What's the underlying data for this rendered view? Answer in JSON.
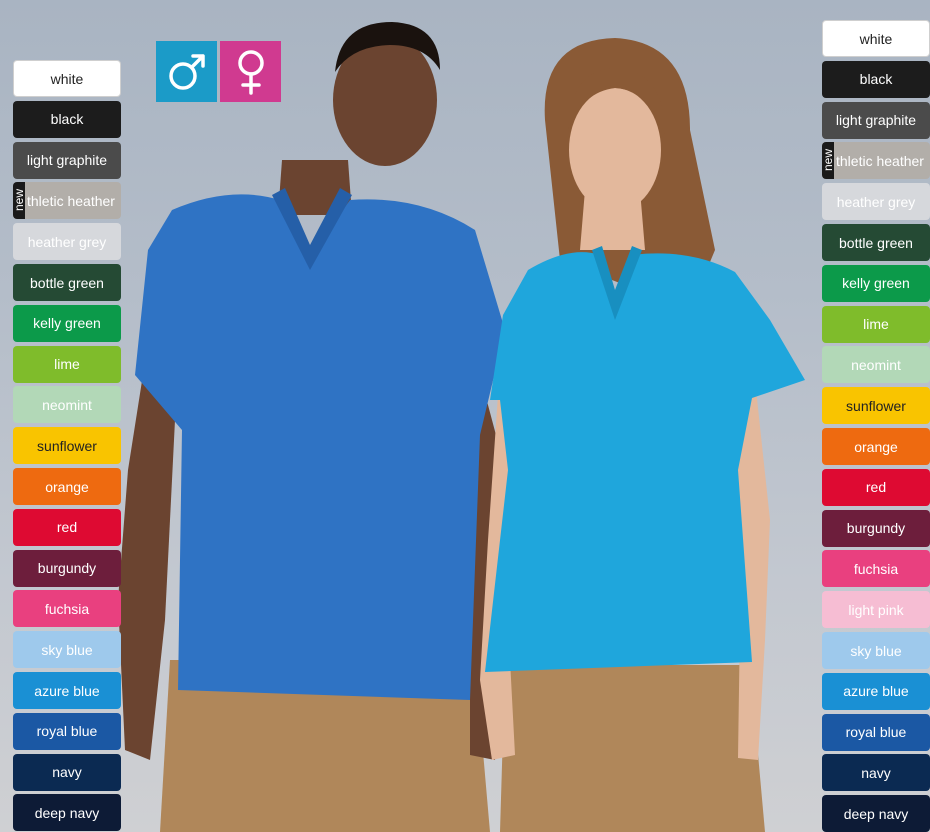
{
  "gender_icons": [
    {
      "name": "male-icon",
      "color": "#1b9bc8"
    },
    {
      "name": "female-icon",
      "color": "#d03a90"
    }
  ],
  "left_colors": [
    {
      "label": "white",
      "bg": "#ffffff",
      "fg": "#222222"
    },
    {
      "label": "black",
      "bg": "#1c1c1c",
      "fg": "#ffffff"
    },
    {
      "label": "light graphite",
      "bg": "#4b4b4b",
      "fg": "#ffffff"
    },
    {
      "label": "thletic heather",
      "bg": "#b2aea9",
      "fg": "#ffffff",
      "badge": "new"
    },
    {
      "label": "heather grey",
      "bg": "#d6d8dc",
      "fg": "#ffffff"
    },
    {
      "label": "bottle green",
      "bg": "#254a34",
      "fg": "#ffffff"
    },
    {
      "label": "kelly green",
      "bg": "#0c9a4a",
      "fg": "#ffffff"
    },
    {
      "label": "lime",
      "bg": "#7fbc2b",
      "fg": "#ffffff"
    },
    {
      "label": "neomint",
      "bg": "#b2d8b7",
      "fg": "#ffffff"
    },
    {
      "label": "sunflower",
      "bg": "#f9c400",
      "fg": "#222222"
    },
    {
      "label": "orange",
      "bg": "#ee6a10",
      "fg": "#ffffff"
    },
    {
      "label": "red",
      "bg": "#de0a32",
      "fg": "#ffffff"
    },
    {
      "label": "burgundy",
      "bg": "#6d1e3c",
      "fg": "#ffffff"
    },
    {
      "label": "fuchsia",
      "bg": "#e9407f",
      "fg": "#ffffff"
    },
    {
      "label": "sky blue",
      "bg": "#9ec9ec",
      "fg": "#ffffff"
    },
    {
      "label": "azure blue",
      "bg": "#1a90d4",
      "fg": "#ffffff"
    },
    {
      "label": "royal blue",
      "bg": "#1b58a4",
      "fg": "#ffffff"
    },
    {
      "label": "navy",
      "bg": "#0b2a52",
      "fg": "#ffffff"
    },
    {
      "label": "deep navy",
      "bg": "#0d1b36",
      "fg": "#ffffff"
    }
  ],
  "right_colors": [
    {
      "label": "white",
      "bg": "#ffffff",
      "fg": "#222222"
    },
    {
      "label": "black",
      "bg": "#1c1c1c",
      "fg": "#ffffff"
    },
    {
      "label": "light graphite",
      "bg": "#4b4b4b",
      "fg": "#ffffff"
    },
    {
      "label": "thletic heather",
      "bg": "#b2aea9",
      "fg": "#ffffff",
      "badge": "new"
    },
    {
      "label": "heather grey",
      "bg": "#d6d8dc",
      "fg": "#ffffff"
    },
    {
      "label": "bottle green",
      "bg": "#254a34",
      "fg": "#ffffff"
    },
    {
      "label": "kelly green",
      "bg": "#0c9a4a",
      "fg": "#ffffff"
    },
    {
      "label": "lime",
      "bg": "#7fbc2b",
      "fg": "#ffffff"
    },
    {
      "label": "neomint",
      "bg": "#b2d8b7",
      "fg": "#ffffff"
    },
    {
      "label": "sunflower",
      "bg": "#f9c400",
      "fg": "#222222"
    },
    {
      "label": "orange",
      "bg": "#ee6a10",
      "fg": "#ffffff"
    },
    {
      "label": "red",
      "bg": "#de0a32",
      "fg": "#ffffff"
    },
    {
      "label": "burgundy",
      "bg": "#6d1e3c",
      "fg": "#ffffff"
    },
    {
      "label": "fuchsia",
      "bg": "#e9407f",
      "fg": "#ffffff"
    },
    {
      "label": "light pink",
      "bg": "#f6bdd3",
      "fg": "#ffffff"
    },
    {
      "label": "sky blue",
      "bg": "#9ec9ec",
      "fg": "#ffffff"
    },
    {
      "label": "azure blue",
      "bg": "#1a90d4",
      "fg": "#ffffff"
    },
    {
      "label": "royal blue",
      "bg": "#1b58a4",
      "fg": "#ffffff"
    },
    {
      "label": "navy",
      "bg": "#0b2a52",
      "fg": "#ffffff"
    },
    {
      "label": "deep navy",
      "bg": "#0d1b36",
      "fg": "#ffffff"
    }
  ],
  "photo": {
    "shirt_colors": {
      "man": "#2f73c4",
      "woman": "#1fa6dc"
    },
    "trouser_color": "#b0875a",
    "skin_colors": {
      "man": "#6b4430",
      "woman": "#e3b89c"
    },
    "hair_colors": {
      "man": "#1a120e",
      "woman": "#8a5a36"
    }
  }
}
